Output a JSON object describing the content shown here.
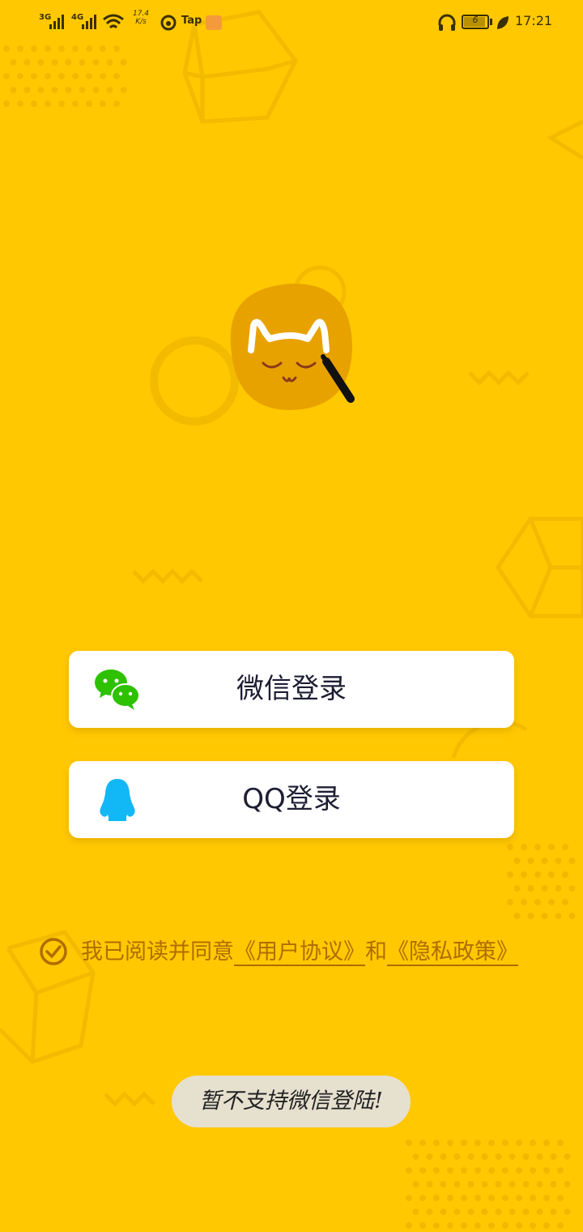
{
  "status_bar": {
    "network_1": "3G",
    "network_2": "4G",
    "speed_value": "17.4",
    "speed_unit": "K/s",
    "tap_label": "Tap",
    "battery_level": "6",
    "time": "17:21"
  },
  "logo": {
    "icon": "cat-logo-icon"
  },
  "login": {
    "wechat_label": "微信登录",
    "wechat_icon": "wechat-icon",
    "qq_label": "QQ登录",
    "qq_icon": "qq-penguin-icon"
  },
  "agreement": {
    "prefix": "我已阅读并同意",
    "user_agreement": "《用户协议》",
    "conjunction": "和",
    "privacy_policy": "《隐私政策》",
    "checked": true
  },
  "toast": {
    "text": "暂不支持微信登陆!"
  },
  "colors": {
    "background": "#FFC800",
    "accent": "#B06D00",
    "logo": "#E8A200",
    "wechat": "#2DC100",
    "qq": "#12B7F5"
  }
}
